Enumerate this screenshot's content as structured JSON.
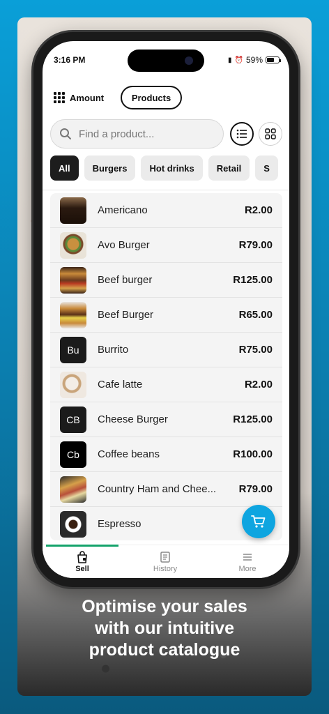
{
  "status": {
    "time": "3:16 PM",
    "battery": "59%"
  },
  "header": {
    "amount_label": "Amount",
    "products_label": "Products"
  },
  "search": {
    "placeholder": "Find a product..."
  },
  "categories": [
    "All",
    "Burgers",
    "Hot drinks",
    "Retail",
    "S"
  ],
  "products": [
    {
      "name": "Americano",
      "price": "R2.00",
      "thumb": "americano"
    },
    {
      "name": "Avo Burger",
      "price": "R79.00",
      "thumb": "avo-burger"
    },
    {
      "name": "Beef burger",
      "price": "R125.00",
      "thumb": "beef-burger"
    },
    {
      "name": "Beef Burger",
      "price": "R65.00",
      "thumb": "beef-burger-2"
    },
    {
      "name": "Burrito",
      "price": "R75.00",
      "thumb": "Bu"
    },
    {
      "name": "Cafe latte",
      "price": "R2.00",
      "thumb": "cafe-latte"
    },
    {
      "name": "Cheese Burger",
      "price": "R125.00",
      "thumb": "CB"
    },
    {
      "name": "Coffee beans",
      "price": "R100.00",
      "thumb": "Cb"
    },
    {
      "name": "Country Ham and Chee...",
      "price": "R79.00",
      "thumb": "sandwich"
    },
    {
      "name": "Espresso",
      "price": "R",
      "thumb": "espresso"
    }
  ],
  "tabs": {
    "sell": "Sell",
    "history": "History",
    "more": "More"
  },
  "headline": [
    "Optimise your sales",
    "with our intuitive",
    "product catalogue"
  ],
  "colors": {
    "accent": "#0ea5e0",
    "active_tab": "#14a36b",
    "chip_active": "#1d1d1d"
  }
}
